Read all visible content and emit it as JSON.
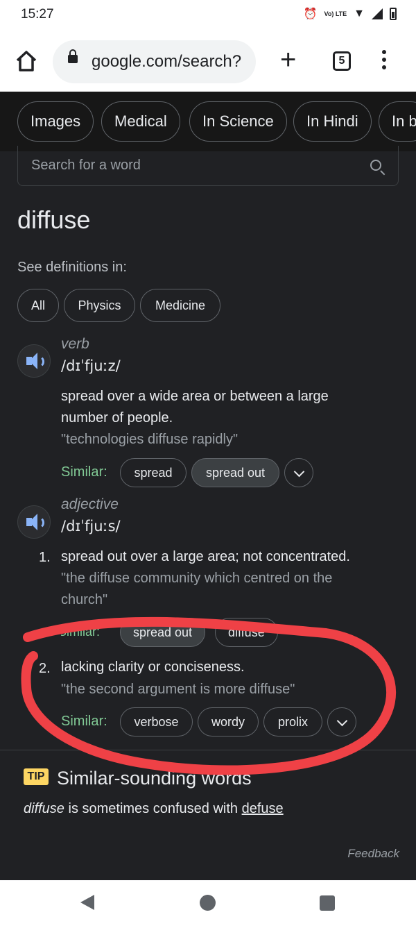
{
  "status_bar": {
    "time": "15:27",
    "network_label": "Vo) LTE"
  },
  "toolbar": {
    "url": "google.com/search?",
    "tab_count": "5"
  },
  "filter_chips": [
    "Images",
    "Medical",
    "In Science",
    "In Hindi",
    "In b"
  ],
  "search_word": {
    "placeholder": "Search for a word"
  },
  "headword": "diffuse",
  "see_definitions": {
    "label": "See definitions in:",
    "chips": [
      "All",
      "Physics",
      "Medicine"
    ]
  },
  "verb": {
    "part_of_speech": "verb",
    "phonetic": "/dɪˈfjuːz/",
    "definition_line1": "spread over a wide area or between a large",
    "definition_line2": "number of people.",
    "example": "\"technologies diffuse rapidly\"",
    "similar_label": "Similar:",
    "similar": [
      "spread",
      "spread out"
    ]
  },
  "adjective": {
    "part_of_speech": "adjective",
    "phonetic": "/dɪˈfjuːs/",
    "senses": [
      {
        "number": "1.",
        "definition": "spread out over a large area; not concentrated.",
        "example_line1": "\"the diffuse community which centred on the",
        "example_line2": "church\"",
        "similar_partial": [
          "Similar:",
          "spread out",
          "diffuse"
        ]
      },
      {
        "number": "2.",
        "definition": "lacking clarity or conciseness.",
        "example": "\"the second argument is more diffuse\"",
        "similar_label": "Similar:",
        "similar": [
          "verbose",
          "wordy",
          "prolix"
        ]
      }
    ]
  },
  "tip": {
    "badge": "TIP",
    "title": "Similar-sounding words",
    "word": "diffuse",
    "middle": " is sometimes confused with ",
    "link": "defuse"
  },
  "feedback": "Feedback",
  "colors": {
    "background": "#202124",
    "similar_label": "#81c995",
    "annotation_stroke": "#ef4146",
    "tip_badge": "#fdd663"
  },
  "icons": [
    "alarm-icon",
    "signal-icon",
    "wifi-icon",
    "battery-icon",
    "home-icon",
    "lock-icon",
    "new-tab-icon",
    "tab-switcher-icon",
    "overflow-menu-icon",
    "search-icon",
    "speaker-icon",
    "chevron-down-icon",
    "back-icon",
    "home-nav-icon",
    "recents-icon"
  ]
}
